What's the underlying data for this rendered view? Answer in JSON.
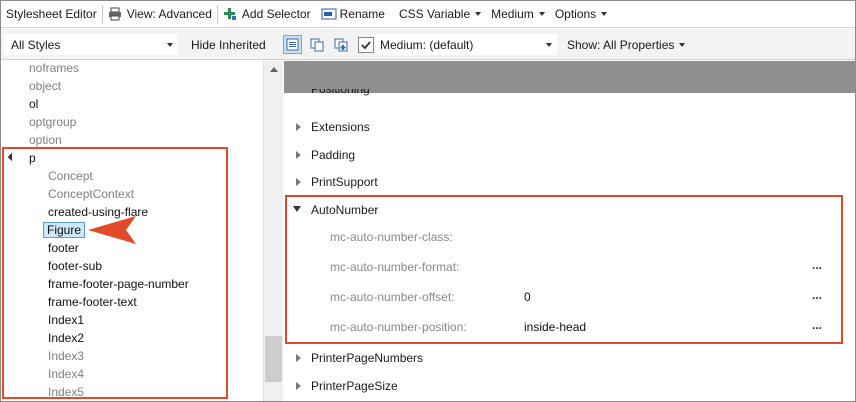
{
  "toolbar": {
    "title": "Stylesheet Editor",
    "view_label": "View: Advanced",
    "add_selector_label": "Add Selector",
    "rename_label": "Rename",
    "css_variable_label": "CSS Variable",
    "medium_menu_label": "Medium",
    "options_label": "Options"
  },
  "filterbar": {
    "styles_combo": "All Styles",
    "hide_inherited": "Hide Inherited",
    "medium_checkbox_checked": true,
    "medium_combo": "Medium: (default)",
    "show_properties": "Show: All Properties"
  },
  "tree": {
    "above": [
      {
        "label": "noframes",
        "tone": "gray"
      },
      {
        "label": "object",
        "tone": "gray"
      },
      {
        "label": "ol",
        "tone": "black"
      },
      {
        "label": "optgroup",
        "tone": "gray"
      },
      {
        "label": "option",
        "tone": "gray"
      }
    ],
    "parent_label": "p",
    "children": [
      {
        "label": "Concept",
        "tone": "gray"
      },
      {
        "label": "ConceptContext",
        "tone": "gray"
      },
      {
        "label": "created-using-flare",
        "tone": "black"
      },
      {
        "label": "Figure",
        "tone": "black",
        "selected": true
      },
      {
        "label": "footer",
        "tone": "black"
      },
      {
        "label": "footer-sub",
        "tone": "black"
      },
      {
        "label": "frame-footer-page-number",
        "tone": "black"
      },
      {
        "label": "frame-footer-text",
        "tone": "black"
      },
      {
        "label": "Index1",
        "tone": "black"
      },
      {
        "label": "Index2",
        "tone": "black"
      },
      {
        "label": "Index3",
        "tone": "gray"
      },
      {
        "label": "Index4",
        "tone": "gray"
      },
      {
        "label": "Index5",
        "tone": "gray"
      }
    ]
  },
  "properties": {
    "partial_label": "Positioning",
    "categories_before": [
      "Extensions",
      "Padding",
      "PrintSupport"
    ],
    "expanded_group": {
      "label": "AutoNumber",
      "items": [
        {
          "name": "mc-auto-number-class:",
          "value": "",
          "has_button": false
        },
        {
          "name": "mc-auto-number-format:",
          "value": "",
          "has_button": true
        },
        {
          "name": "mc-auto-number-offset:",
          "value": "0",
          "has_button": true
        },
        {
          "name": "mc-auto-number-position:",
          "value": "inside-head",
          "has_button": true
        }
      ]
    },
    "categories_after": [
      "PrinterPageNumbers",
      "PrinterPageSize"
    ],
    "browse_button_label": "..."
  },
  "colors": {
    "annotation": "#e04a2a",
    "selection": "#cde8f7",
    "header_bar": "#8f8f8f"
  }
}
